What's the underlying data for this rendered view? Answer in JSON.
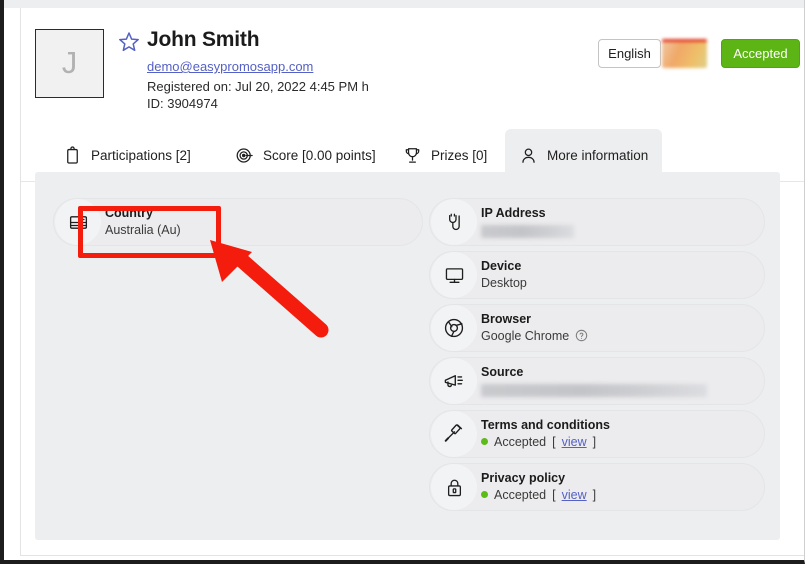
{
  "header": {
    "avatar_letter": "J",
    "favorite_icon": "star-icon",
    "name": "John Smith",
    "email": "demo@easypromosapp.com",
    "registered_on": "Registered on: Jul 20, 2022 4:45 PM h",
    "user_id": "ID: 3904974",
    "language_button": "English",
    "status_button": "Accepted",
    "status_color": "#5cb415",
    "link_color": "#5561c4"
  },
  "tabs": [
    {
      "label": "Participations [2]",
      "icon": "clipboard-icon",
      "active": false
    },
    {
      "label": "Score [0.00 points]",
      "icon": "target-icon",
      "active": false
    },
    {
      "label": "Prizes [0]",
      "icon": "trophy-icon",
      "active": false
    },
    {
      "label": "More information",
      "icon": "person-icon",
      "active": true
    }
  ],
  "info": {
    "left_column": [
      {
        "title": "Country",
        "value": "Australia (Au)",
        "icon": "id-card-icon"
      }
    ],
    "right_column": [
      {
        "title": "IP Address",
        "value": "",
        "icon": "plug-icon",
        "redacted": true
      },
      {
        "title": "Device",
        "value": "Desktop",
        "icon": "monitor-icon"
      },
      {
        "title": "Browser",
        "value": "Google Chrome",
        "icon": "chrome-icon",
        "help": "?"
      },
      {
        "title": "Source",
        "value": "",
        "icon": "megaphone-icon",
        "redacted": true
      },
      {
        "title": "Terms and conditions",
        "value": "Accepted",
        "icon": "gavel-icon",
        "link": "view",
        "dot": "#5cbb16"
      },
      {
        "title": "Privacy policy",
        "value": "Accepted",
        "icon": "lock-icon",
        "link": "view",
        "dot": "#5cbb16"
      }
    ]
  },
  "annotation": {
    "highlight_color": "#f41c0c",
    "arrow_color": "#f41c0c",
    "target": "Country"
  }
}
